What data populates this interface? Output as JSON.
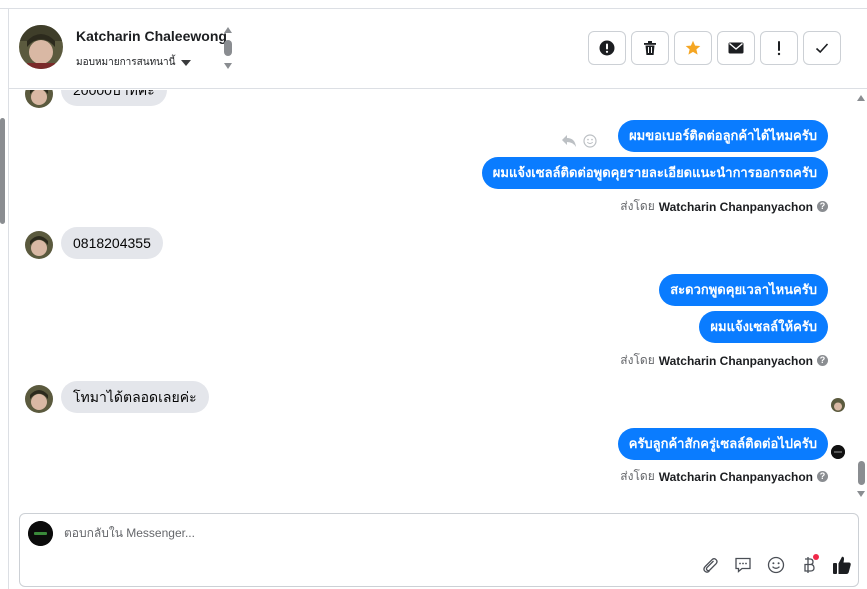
{
  "header": {
    "contact_name": "Katcharin Chaleewong",
    "assign_label": "มอบหมายการสนทนานี้",
    "actions": [
      {
        "name": "spam-button",
        "icon": "alert-circle-icon"
      },
      {
        "name": "delete-button",
        "icon": "trash-icon"
      },
      {
        "name": "star-button",
        "icon": "star-icon",
        "color": "#f5a623"
      },
      {
        "name": "mark-unread-button",
        "icon": "envelope-icon"
      },
      {
        "name": "follow-up-button",
        "icon": "exclamation-icon"
      },
      {
        "name": "mark-done-button",
        "icon": "check-icon"
      }
    ]
  },
  "thread": {
    "partial_top_message": "20000บาทค่ะ",
    "messages": [
      {
        "from": "customer",
        "text": "0818204355"
      },
      {
        "from": "customer",
        "text": "โทมาได้ตลอดเลยค่ะ"
      }
    ],
    "outgoing_groups": [
      {
        "messages": [
          "ผมขอเบอร์ติดต่อลูกค้าได้ไหมครับ",
          "ผมแจ้งเซลล์ติดต่อพูดคุยรายละเอียดแนะนำการออกรถครับ"
        ],
        "sent_by_label": "ส่งโดย",
        "sender": "Watcharin Chanpanyachon"
      },
      {
        "messages": [
          "สะดวกพูดคุยเวลาไหนครับ",
          "ผมแจ้งเซลล์ให้ครับ"
        ],
        "sent_by_label": "ส่งโดย",
        "sender": "Watcharin Chanpanyachon"
      },
      {
        "messages": [
          "ครับลูกค้าสักครู่เซลล์ติดต่อไปครับ"
        ],
        "sent_by_label": "ส่งโดย",
        "sender": "Watcharin Chanpanyachon"
      }
    ],
    "help_mark": "?"
  },
  "composer": {
    "placeholder": "ตอบกลับใน Messenger...",
    "tools": [
      "paperclip-icon",
      "saved-reply-icon",
      "emoji-icon",
      "baht-payment-icon",
      "like-icon"
    ]
  },
  "colors": {
    "outgoing_bubble": "#0a7cff",
    "incoming_bubble": "#e4e6eb",
    "star": "#f5a623",
    "notification_dot": "#f02849"
  }
}
